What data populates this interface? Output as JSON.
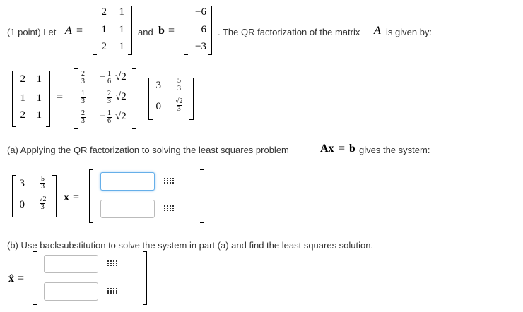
{
  "problem": {
    "points": "(1 point) Let",
    "var_A": "A",
    "eq": "=",
    "matrix_A": [
      [
        "2",
        "1"
      ],
      [
        "1",
        "1"
      ],
      [
        "2",
        "1"
      ]
    ],
    "and": "and",
    "var_b": "b",
    "vector_b": [
      "−6",
      "6",
      "−3"
    ],
    "description": ". The QR factorization of the matrix",
    "given": "is given by:"
  },
  "qr": {
    "Q": [
      [
        {
          "num": "2",
          "den": "3"
        },
        {
          "sign": "−",
          "num": "1",
          "den": "6",
          "rad": "√2"
        }
      ],
      [
        {
          "num": "1",
          "den": "3"
        },
        {
          "sign": "",
          "num": "2",
          "den": "3",
          "rad": "√2"
        }
      ],
      [
        {
          "num": "2",
          "den": "3"
        },
        {
          "sign": "−",
          "num": "1",
          "den": "6",
          "rad": "√2"
        }
      ]
    ],
    "R": [
      [
        "3",
        {
          "num": "5",
          "den": "3"
        }
      ],
      [
        "0",
        {
          "num": "√2",
          "den": "3"
        }
      ]
    ]
  },
  "part_a": {
    "label": "(a) Applying the QR factorization to solving the least squares problem",
    "ax": "Ax",
    "b": "b",
    "suffix": "gives the system:",
    "x": "x",
    "inputs": [
      "",
      ""
    ]
  },
  "part_b": {
    "label": "(b) Use backsubstitution to solve the system in part (a) and find the least squares solution.",
    "xhat": "x̂",
    "inputs": [
      "",
      ""
    ]
  },
  "colors": {
    "focus": "#66afe9",
    "border": "#bbbbbb"
  },
  "icons": [
    "matrix-grid-icon"
  ]
}
